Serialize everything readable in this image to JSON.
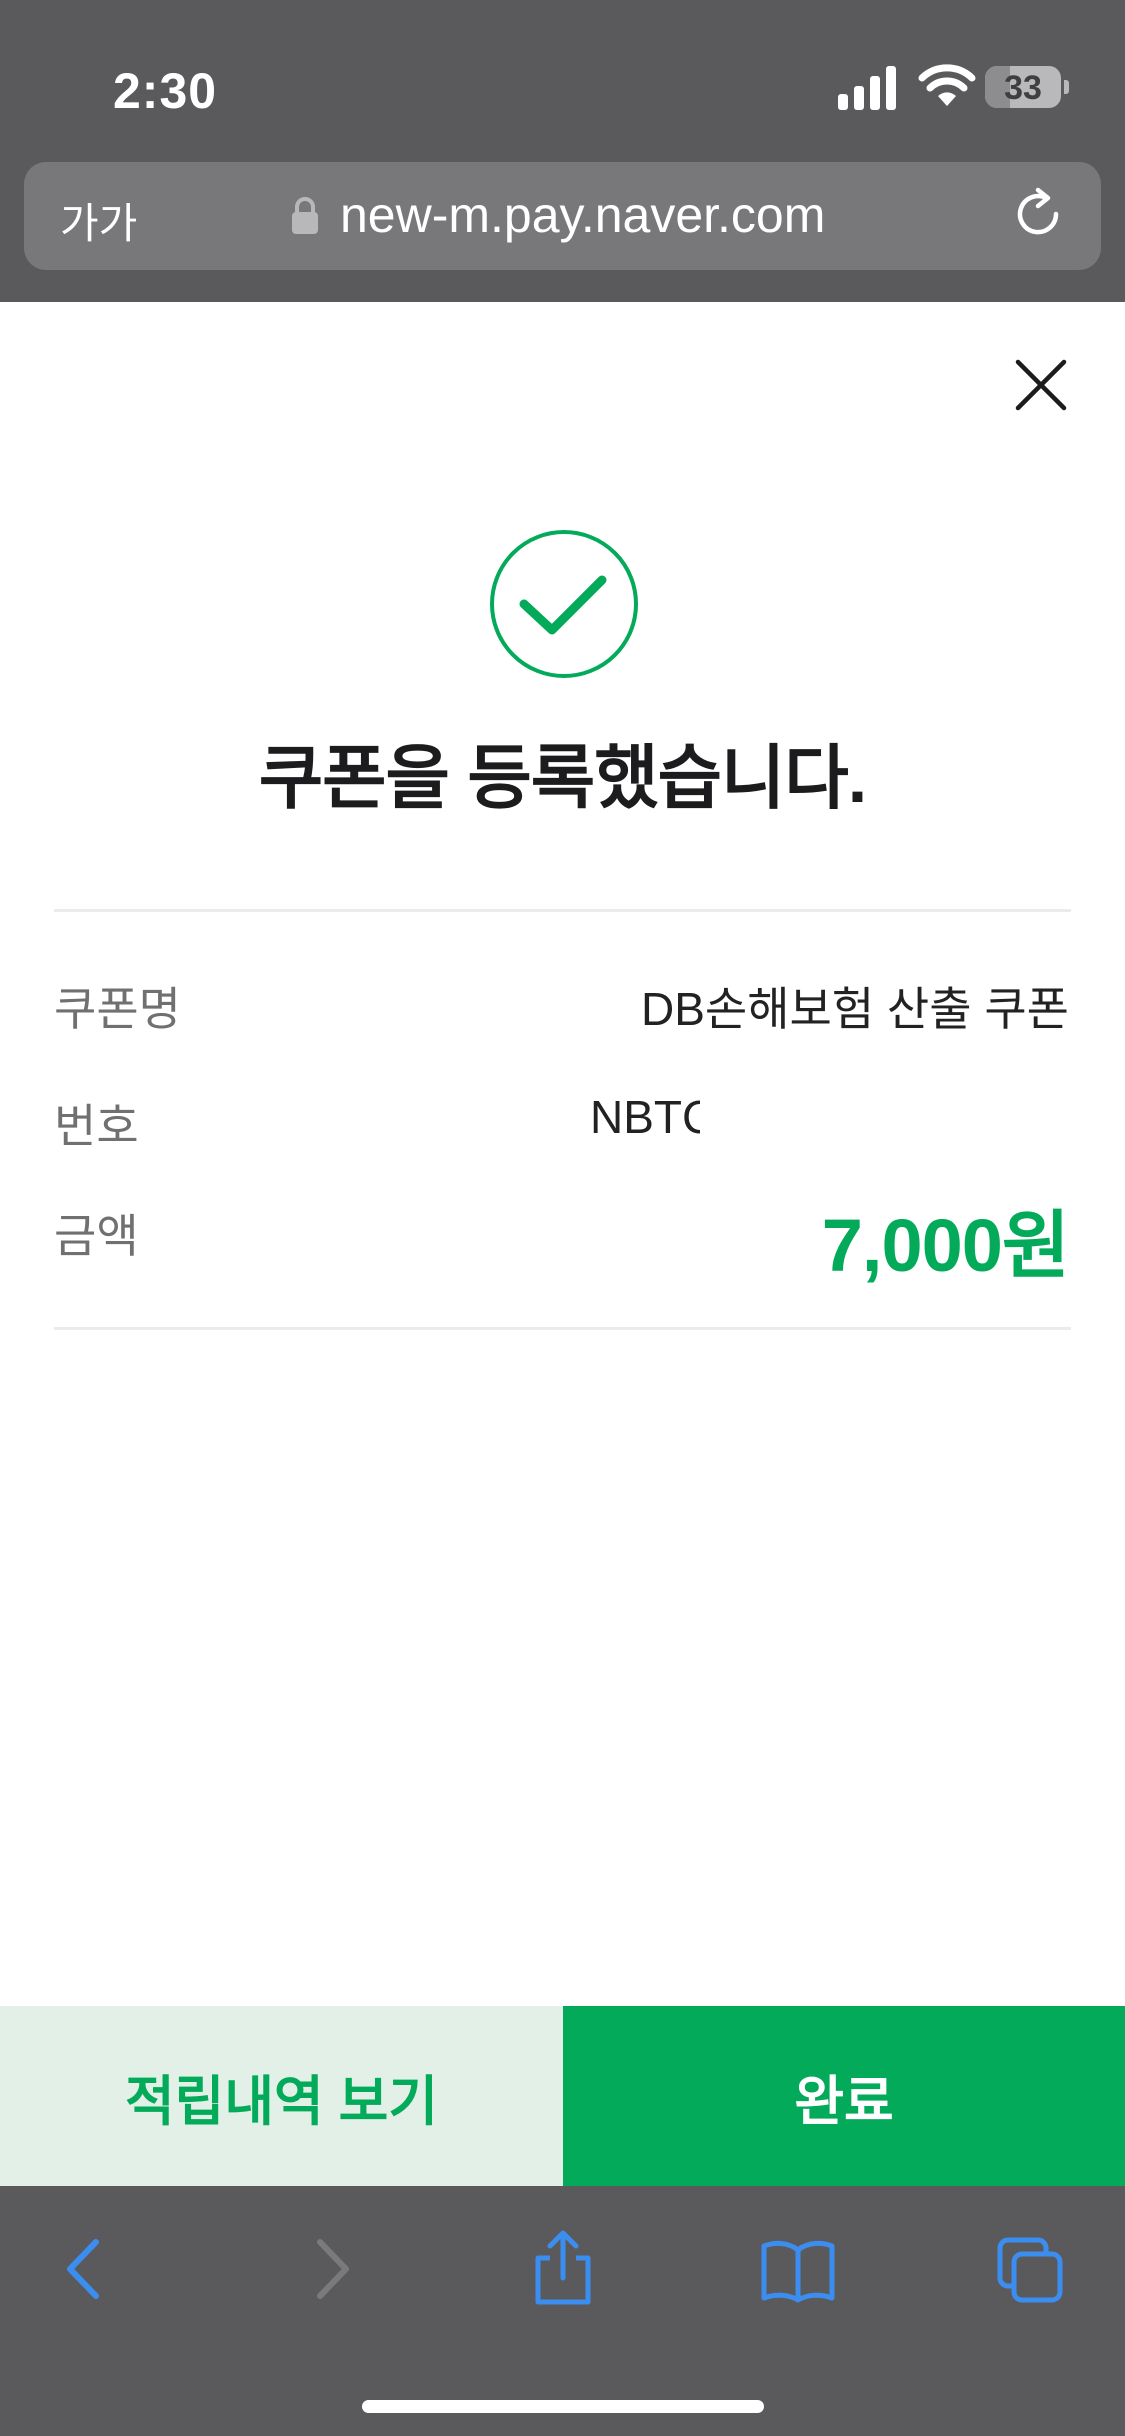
{
  "status_bar": {
    "time": "2:30",
    "battery": "33",
    "battery_level": 0.33
  },
  "browser": {
    "text_size_label": "가가",
    "url": "new-m.pay.naver.com"
  },
  "result": {
    "title": "쿠폰을 등록했습니다.",
    "rows": [
      {
        "label": "쿠폰명",
        "value": "DB손해보험 산출 쿠폰"
      },
      {
        "label": "번호",
        "value": "NBTC"
      },
      {
        "label": "금액",
        "value": "7,000원"
      }
    ]
  },
  "actions": {
    "history_label": "적립내역 보기",
    "done_label": "완료"
  },
  "icons": {
    "close": "close-icon",
    "success": "check-circle-icon",
    "lock": "lock-icon",
    "reload": "reload-icon",
    "back": "chevron-left-icon",
    "forward": "chevron-right-icon",
    "share": "share-icon",
    "bookmarks": "book-icon",
    "tabs": "tabs-icon"
  },
  "colors": {
    "accent": "#03aa5a",
    "accent_light": "#e3f0e8",
    "chrome": "#5a5a5c",
    "toolbar_icon": "#3b8ef0"
  }
}
